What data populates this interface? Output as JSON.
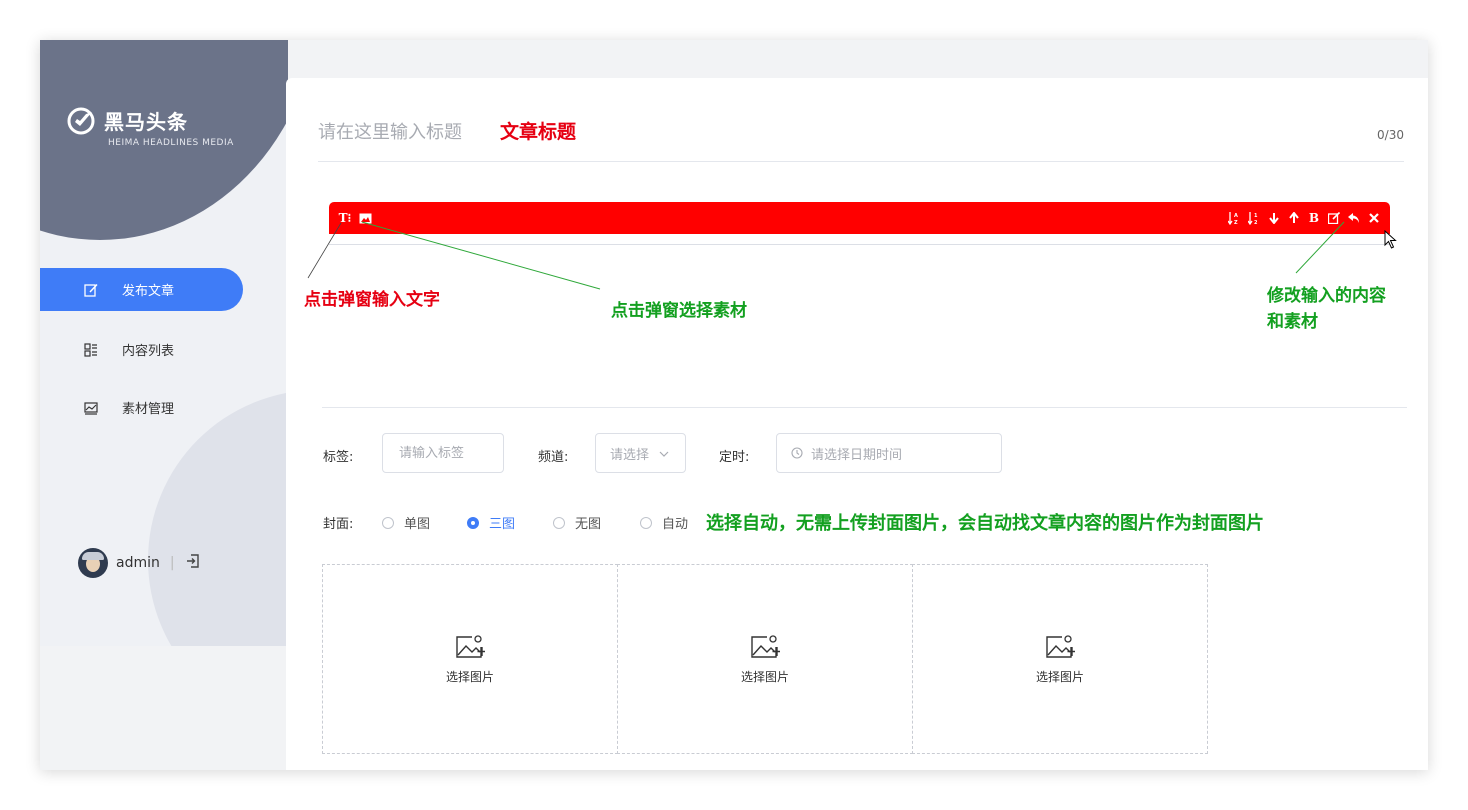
{
  "sidebar": {
    "logo_cn": "黑马头条",
    "logo_en": "HEIMA HEADLINES MEDIA",
    "menu": [
      {
        "label": "发布文章",
        "icon": "edit-icon",
        "active": true
      },
      {
        "label": "内容列表",
        "icon": "list-icon",
        "active": false
      },
      {
        "label": "素材管理",
        "icon": "image-icon",
        "active": false
      }
    ],
    "user": {
      "name": "admin",
      "separator": "|"
    }
  },
  "editor": {
    "title_placeholder": "请在这里输入标题",
    "title_count": "0/30",
    "toolbar_left": [
      {
        "icon": "text-icon",
        "glyph": "T⁝"
      },
      {
        "icon": "image-icon"
      }
    ],
    "toolbar_right": [
      "sort-az-icon",
      "sort-za-icon",
      "arrow-down-icon",
      "arrow-up-icon",
      "bold-icon",
      "edit-icon",
      "undo-icon",
      "close-icon"
    ]
  },
  "annotations": {
    "title": "文章标题",
    "text_popup": "点击弹窗输入文字",
    "material_popup": "点击弹窗选择素材",
    "modify_line1": "修改输入的内容",
    "modify_line2": "和素材",
    "auto_cover": "选择自动，无需上传封面图片，会自动找文章内容的图片作为封面图片"
  },
  "form": {
    "tag_label": "标签:",
    "tag_placeholder": "请输入标签",
    "channel_label": "频道:",
    "channel_placeholder": "请选择",
    "time_label": "定时:",
    "time_placeholder": "请选择日期时间",
    "cover_label": "封面:",
    "cover_options": [
      {
        "label": "单图",
        "checked": false
      },
      {
        "label": "三图",
        "checked": true
      },
      {
        "label": "无图",
        "checked": false
      },
      {
        "label": "自动",
        "checked": false
      }
    ],
    "upload_label": "选择图片",
    "upload_count": 3
  },
  "colors": {
    "accent": "#3f7cf7",
    "toolbar": "#ff0000",
    "annot_red": "#e60012",
    "annot_green": "#13a020",
    "sidebar_dark": "#6b7389"
  }
}
